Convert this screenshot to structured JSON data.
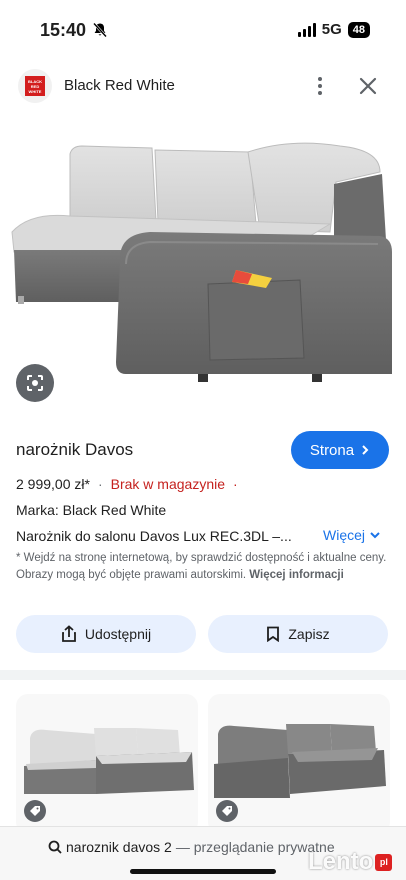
{
  "status_bar": {
    "time": "15:40",
    "network": "5G",
    "battery": "48"
  },
  "header": {
    "title": "Black Red White",
    "logo_text": "BLACK RED WHITE",
    "brand_color": "#d31e1e"
  },
  "product": {
    "title": "narożnik Davos",
    "visit_label": "Strona",
    "price": "2 999,00 zł*",
    "stock": "Brak w magazynie",
    "brand_line": "Marka: Black Red White",
    "description": "Narożnik do salonu Davos Lux REC.3DL –...",
    "more_label": "Więcej",
    "disclaimer": "* Wejdź na stronę internetową, by sprawdzić dostępność i aktualne ceny. Obrazy mogą być objęte prawami autorskimi.",
    "disclaimer_link": "Więcej informacji",
    "accent_color": "#1a73e8",
    "stock_color": "#c5221f"
  },
  "actions": {
    "share_label": "Udostępnij",
    "save_label": "Zapisz"
  },
  "icons": {
    "lens": "lens-icon",
    "share": "share-icon",
    "bookmark": "bookmark-icon",
    "tag": "tag-icon",
    "search": "search-icon",
    "close": "close-icon",
    "menu": "more-vert-icon"
  },
  "bottom_bar": {
    "query": "naroznik davos 2",
    "private_label": "— przeglądanie prywatne"
  },
  "watermark": {
    "text": "Lento",
    "badge": "pl"
  }
}
